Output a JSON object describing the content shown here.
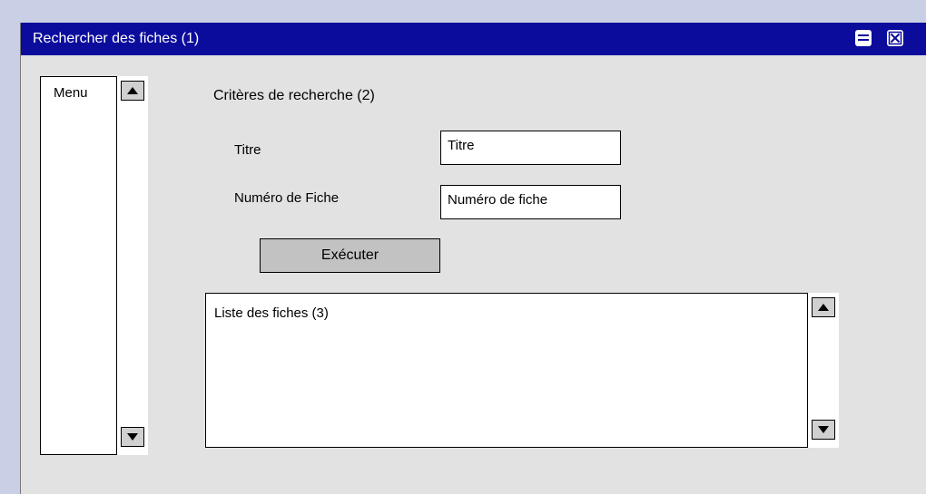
{
  "window": {
    "title": "Rechercher des fiches (1)"
  },
  "menu": {
    "label": "Menu"
  },
  "search": {
    "section_title": "Critères de recherche (2)",
    "title_label": "Titre",
    "title_value": "Titre",
    "number_label": "Numéro de Fiche",
    "number_value": "Numéro de fiche",
    "run_label": "Exécuter"
  },
  "results": {
    "title": "Liste des fiches (3)"
  },
  "icons": {
    "maximize": "maximize-icon",
    "close": "close-icon",
    "scroll_up": "arrow-up-icon",
    "scroll_down": "arrow-down-icon"
  },
  "colors": {
    "titlebar": "#0c0c9c",
    "window_bg": "#e2e2e2",
    "desktop": "#c9d0e6",
    "button": "#c2c2c2"
  }
}
